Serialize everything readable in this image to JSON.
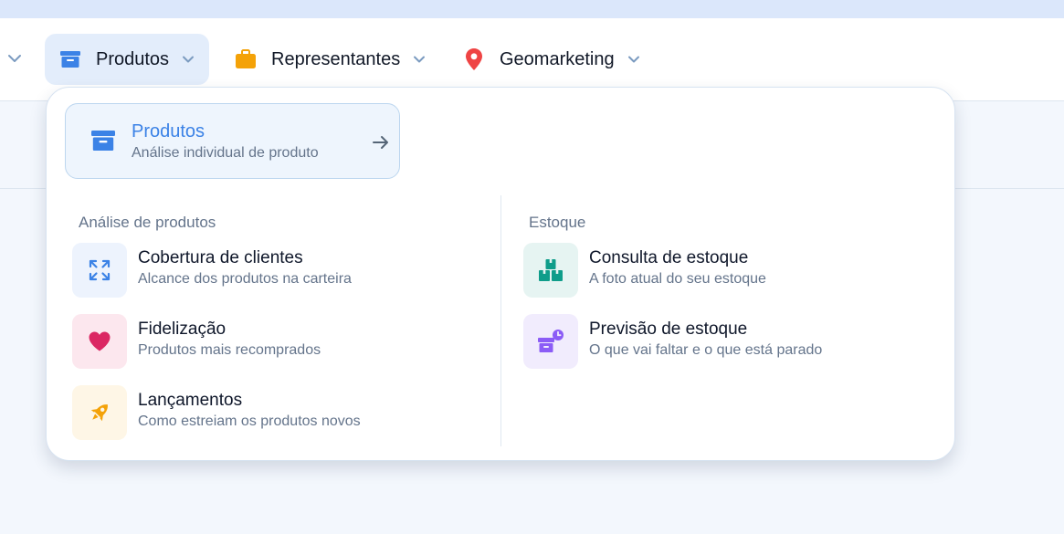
{
  "colors": {
    "accent": "#3b82e6",
    "nav_active_bg": "#e3edfb",
    "tile_blue": "#edf3fd",
    "tile_pink": "#fce7ee",
    "tile_yellow": "#fef6e6",
    "tile_teal": "#e6f4f2",
    "tile_purple": "#f1ecfd"
  },
  "nav": {
    "items": [
      {
        "label": "Produtos",
        "icon": "archive-box-icon",
        "active": true
      },
      {
        "label": "Representantes",
        "icon": "briefcase-icon",
        "active": false
      },
      {
        "label": "Geomarketing",
        "icon": "map-pin-icon",
        "active": false
      }
    ]
  },
  "dropdown": {
    "hero": {
      "title": "Produtos",
      "subtitle": "Análise individual de produto",
      "icon": "archive-box-icon",
      "arrow_icon": "arrow-right-icon"
    },
    "sections": [
      {
        "title": "Análise de produtos",
        "items": [
          {
            "title": "Cobertura de clientes",
            "subtitle": "Alcance dos produtos na carteira",
            "icon": "expand-arrows-icon"
          },
          {
            "title": "Fidelização",
            "subtitle": "Produtos mais recomprados",
            "icon": "heart-icon"
          },
          {
            "title": "Lançamentos",
            "subtitle": "Como estreiam os produtos novos",
            "icon": "rocket-icon"
          }
        ]
      },
      {
        "title": "Estoque",
        "items": [
          {
            "title": "Consulta de estoque",
            "subtitle": "A foto atual do seu estoque",
            "icon": "boxes-stack-icon"
          },
          {
            "title": "Previsão de estoque",
            "subtitle": "O que vai faltar e o que está parado",
            "icon": "box-clock-icon"
          }
        ]
      }
    ]
  }
}
